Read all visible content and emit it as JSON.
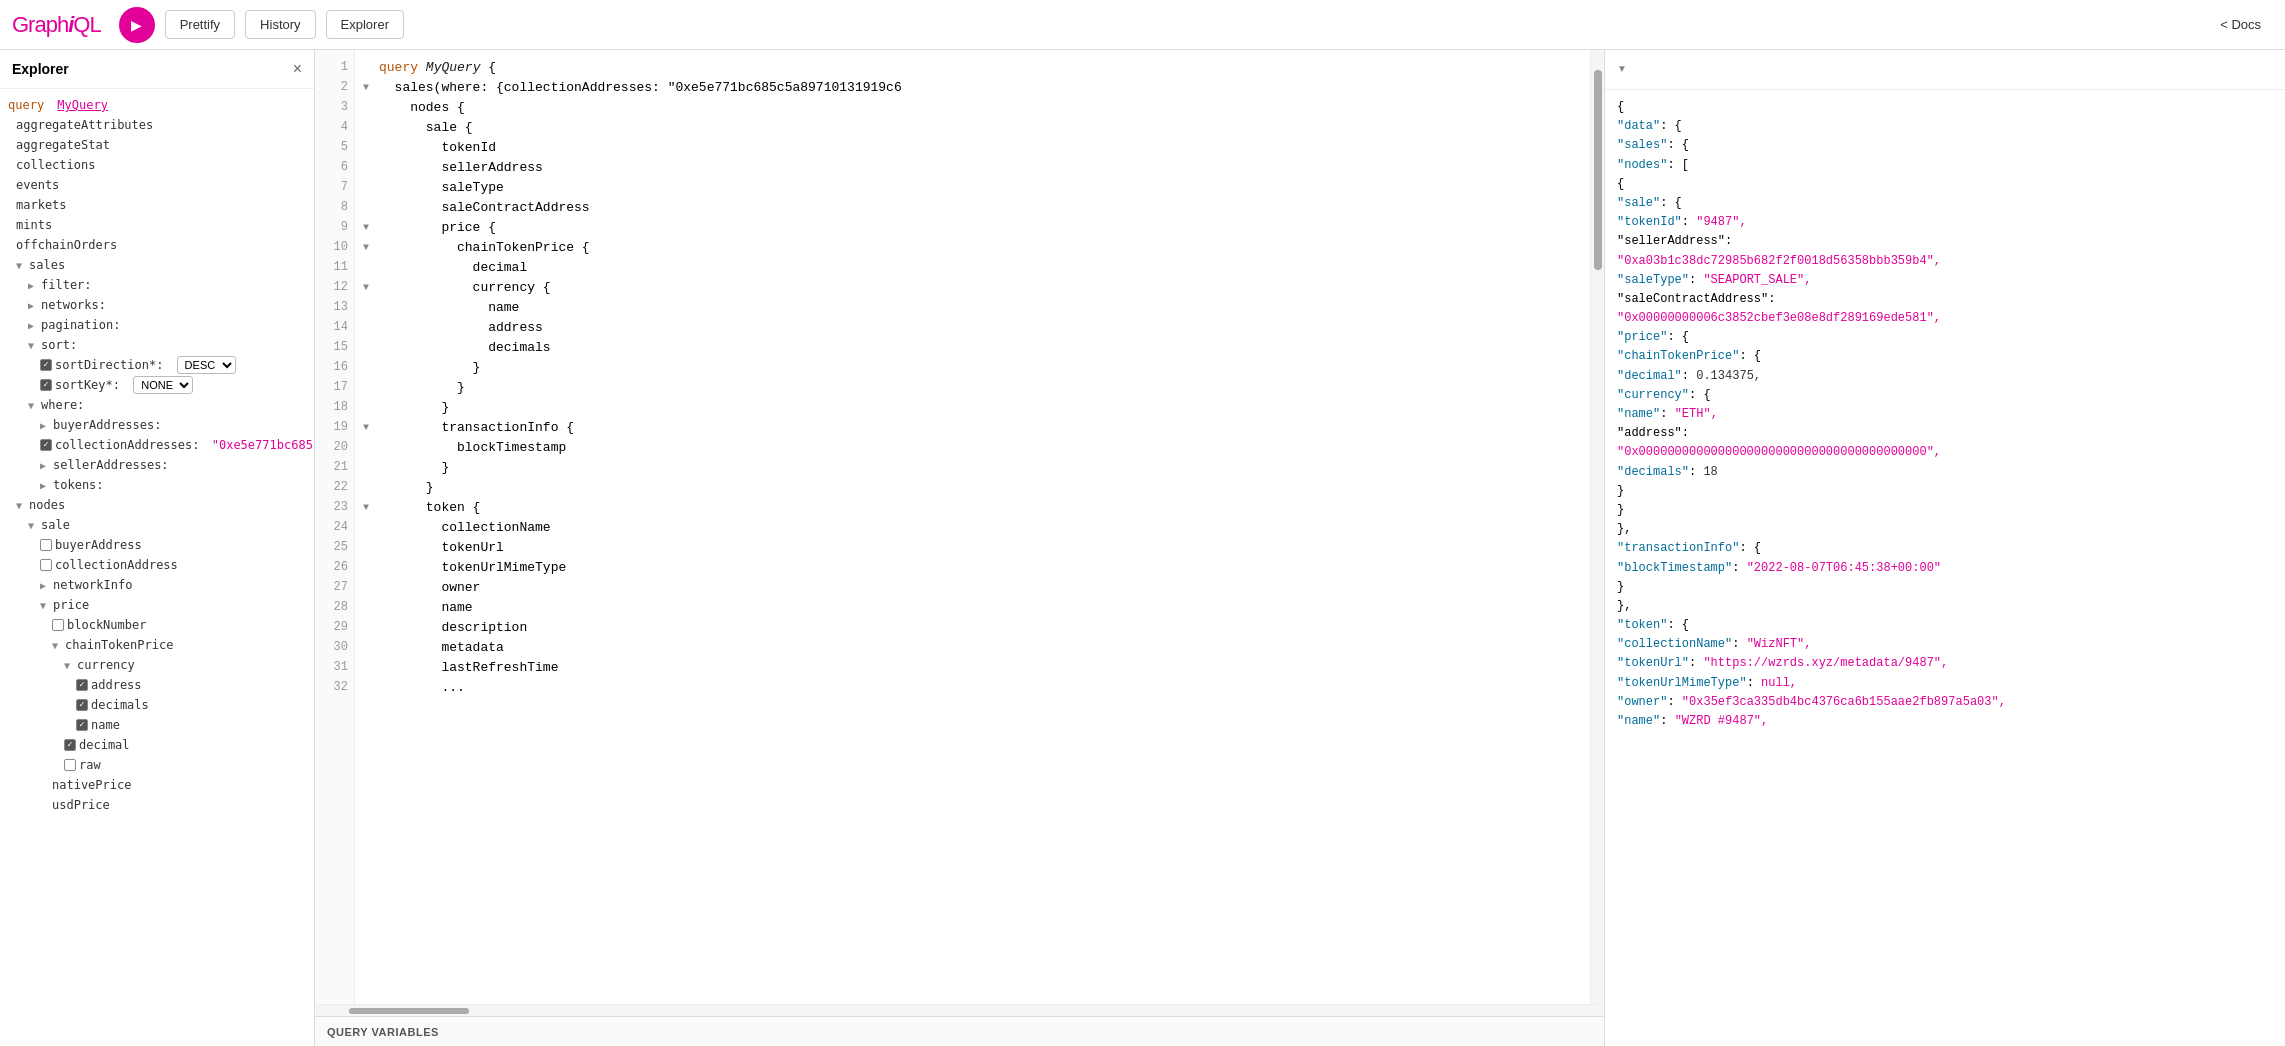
{
  "topbar": {
    "logo": "GraphiQL",
    "play_label": "▶",
    "prettify_label": "Prettify",
    "history_label": "History",
    "explorer_label": "Explorer",
    "docs_label": "< Docs"
  },
  "sidebar": {
    "title": "Explorer",
    "close_label": "×",
    "query_keyword": "query",
    "query_name": "MyQuery",
    "items": [
      {
        "label": "aggregateAttributes",
        "indent": 1,
        "type": "field"
      },
      {
        "label": "aggregateStat",
        "indent": 1,
        "type": "field"
      },
      {
        "label": "collections",
        "indent": 1,
        "type": "field"
      },
      {
        "label": "events",
        "indent": 1,
        "type": "field"
      },
      {
        "label": "markets",
        "indent": 1,
        "type": "field"
      },
      {
        "label": "mints",
        "indent": 1,
        "type": "field"
      },
      {
        "label": "offchainOrders",
        "indent": 1,
        "type": "field"
      },
      {
        "label": "sales",
        "indent": 1,
        "type": "field-expanded"
      },
      {
        "label": "filter:",
        "indent": 2,
        "type": "arrow"
      },
      {
        "label": "networks:",
        "indent": 2,
        "type": "arrow"
      },
      {
        "label": "pagination:",
        "indent": 2,
        "type": "arrow"
      },
      {
        "label": "sort:",
        "indent": 2,
        "type": "arrow-expanded"
      },
      {
        "label": "sortDirection*:",
        "indent": 3,
        "type": "checkbox-checked",
        "extra": "DESC ▼"
      },
      {
        "label": "sortKey*:",
        "indent": 3,
        "type": "checkbox-checked",
        "extra": "NONE ▼"
      },
      {
        "label": "where:",
        "indent": 2,
        "type": "arrow-expanded"
      },
      {
        "label": "buyerAddresses:",
        "indent": 3,
        "type": "arrow"
      },
      {
        "label": "collectionAddresses:",
        "indent": 3,
        "type": "checkbox-checked",
        "extra": "\"0xe5e771bc685\""
      },
      {
        "label": "sellerAddresses:",
        "indent": 3,
        "type": "arrow"
      },
      {
        "label": "tokens:",
        "indent": 3,
        "type": "arrow"
      },
      {
        "label": "nodes",
        "indent": 1,
        "type": "arrow-expanded"
      },
      {
        "label": "sale",
        "indent": 2,
        "type": "arrow-expanded"
      },
      {
        "label": "buyerAddress",
        "indent": 3,
        "type": "checkbox"
      },
      {
        "label": "collectionAddress",
        "indent": 3,
        "type": "checkbox"
      },
      {
        "label": "networkInfo",
        "indent": 3,
        "type": "arrow"
      },
      {
        "label": "price",
        "indent": 3,
        "type": "arrow-expanded"
      },
      {
        "label": "blockNumber",
        "indent": 4,
        "type": "checkbox"
      },
      {
        "label": "chainTokenPrice",
        "indent": 4,
        "type": "arrow-expanded"
      },
      {
        "label": "currency",
        "indent": 5,
        "type": "arrow-expanded"
      },
      {
        "label": "address",
        "indent": 6,
        "type": "checkbox-checked"
      },
      {
        "label": "decimals",
        "indent": 6,
        "type": "checkbox-checked"
      },
      {
        "label": "name",
        "indent": 6,
        "type": "checkbox-checked"
      },
      {
        "label": "decimal",
        "indent": 5,
        "type": "checkbox-checked"
      },
      {
        "label": "raw",
        "indent": 5,
        "type": "checkbox"
      },
      {
        "label": "nativePrice",
        "indent": 4,
        "type": "field"
      },
      {
        "label": "usdPrice",
        "indent": 4,
        "type": "field"
      }
    ]
  },
  "editor": {
    "lines": [
      {
        "num": 1,
        "arrow": false,
        "code": "query MyQuery {",
        "parts": [
          {
            "t": "keyword",
            "v": "query"
          },
          {
            "t": "space",
            "v": " "
          },
          {
            "t": "name",
            "v": "MyQuery"
          },
          {
            "t": "space",
            "v": " {"
          }
        ]
      },
      {
        "num": 2,
        "arrow": true,
        "code": "  sales(where: {collectionAddresses: \"0xe5e771bc685c5a89710131919c6",
        "parts": []
      },
      {
        "num": 3,
        "arrow": false,
        "code": "    nodes {",
        "parts": []
      },
      {
        "num": 4,
        "arrow": false,
        "code": "      sale {",
        "parts": []
      },
      {
        "num": 5,
        "arrow": false,
        "code": "        tokenId",
        "parts": []
      },
      {
        "num": 6,
        "arrow": false,
        "code": "        sellerAddress",
        "parts": []
      },
      {
        "num": 7,
        "arrow": false,
        "code": "        saleType",
        "parts": []
      },
      {
        "num": 8,
        "arrow": false,
        "code": "        saleContractAddress",
        "parts": []
      },
      {
        "num": 9,
        "arrow": true,
        "code": "        price {",
        "parts": []
      },
      {
        "num": 10,
        "arrow": true,
        "code": "          chainTokenPrice {",
        "parts": []
      },
      {
        "num": 11,
        "arrow": false,
        "code": "            decimal",
        "parts": []
      },
      {
        "num": 12,
        "arrow": true,
        "code": "            currency {",
        "parts": []
      },
      {
        "num": 13,
        "arrow": false,
        "code": "              name",
        "parts": []
      },
      {
        "num": 14,
        "arrow": false,
        "code": "              address",
        "parts": []
      },
      {
        "num": 15,
        "arrow": false,
        "code": "              decimals",
        "parts": []
      },
      {
        "num": 16,
        "arrow": false,
        "code": "            }",
        "parts": []
      },
      {
        "num": 17,
        "arrow": false,
        "code": "          }",
        "parts": []
      },
      {
        "num": 18,
        "arrow": false,
        "code": "        }",
        "parts": []
      },
      {
        "num": 19,
        "arrow": true,
        "code": "        transactionInfo {",
        "parts": []
      },
      {
        "num": 20,
        "arrow": false,
        "code": "          blockTimestamp",
        "parts": []
      },
      {
        "num": 21,
        "arrow": false,
        "code": "        }",
        "parts": []
      },
      {
        "num": 22,
        "arrow": false,
        "code": "      }",
        "parts": []
      },
      {
        "num": 23,
        "arrow": true,
        "code": "      token {",
        "parts": []
      },
      {
        "num": 24,
        "arrow": false,
        "code": "        collectionName",
        "parts": []
      },
      {
        "num": 25,
        "arrow": false,
        "code": "        tokenUrl",
        "parts": []
      },
      {
        "num": 26,
        "arrow": false,
        "code": "        tokenUrlMimeType",
        "parts": []
      },
      {
        "num": 27,
        "arrow": false,
        "code": "        owner",
        "parts": []
      },
      {
        "num": 28,
        "arrow": false,
        "code": "        name",
        "parts": []
      },
      {
        "num": 29,
        "arrow": false,
        "code": "        description",
        "parts": []
      },
      {
        "num": 30,
        "arrow": false,
        "code": "        metadata",
        "parts": []
      },
      {
        "num": 31,
        "arrow": false,
        "code": "        lastRefreshTime",
        "parts": []
      },
      {
        "num": 32,
        "arrow": false,
        "code": "        ...",
        "parts": []
      }
    ],
    "query_variables_label": "QUERY VARIABLES"
  },
  "result": {
    "lines": [
      "{",
      "  \"data\": {",
      "    \"sales\": {",
      "      \"nodes\": [",
      "        {",
      "          \"sale\": {",
      "            \"tokenId\": \"9487\",",
      "            \"sellerAddress\":",
      "\"0xa03b1c38dc72985b682f2f0018d56358bbb359b4\",",
      "            \"saleType\": \"SEAPORT_SALE\",",
      "            \"saleContractAddress\":",
      "\"0x00000000006c3852cbef3e08e8df289169ede581\",",
      "            \"price\": {",
      "              \"chainTokenPrice\": {",
      "                \"decimal\": 0.134375,",
      "                \"currency\": {",
      "                  \"name\": \"ETH\",",
      "                  \"address\":",
      "\"0x0000000000000000000000000000000000000000\",",
      "                  \"decimals\": 18",
      "                }",
      "              }",
      "            },",
      "            \"transactionInfo\": {",
      "              \"blockTimestamp\": \"2022-08-07T06:45:38+00:00\"",
      "            }",
      "          },",
      "          \"token\": {",
      "            \"collectionName\": \"WizNFT\",",
      "            \"tokenUrl\": \"https://wzrds.xyz/metadata/9487\",",
      "            \"tokenUrlMimeType\": null,",
      "            \"owner\": \"0x35ef3ca335db4bc4376ca6b155aae2fb897a5a03\",",
      "            \"name\": \"WZRD #9487\","
    ]
  }
}
